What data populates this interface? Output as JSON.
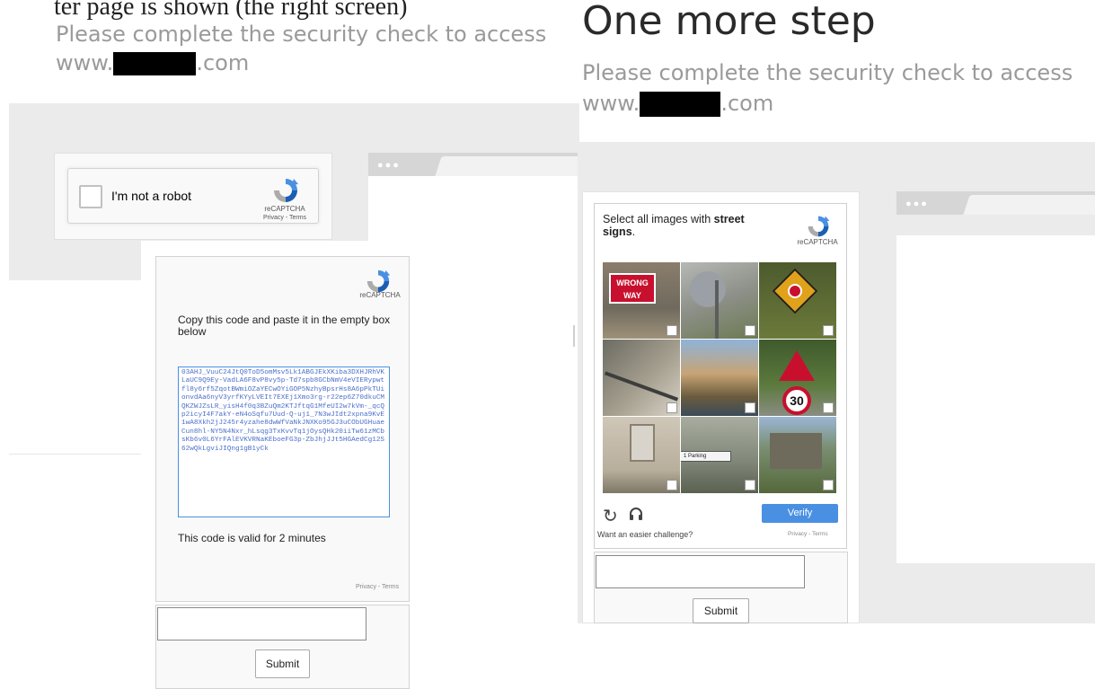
{
  "left_panel": {
    "cropped_caption": "ter page is shown (the right screen)",
    "subtitle_prefix": "Please complete the security check to access",
    "url_prefix": "www.",
    "url_suffix": ".com",
    "checkbox_widget": {
      "label": "I'm not a robot",
      "brand": "reCAPTCHA",
      "links": "Privacy - Terms"
    },
    "code_widget": {
      "brand": "reCAPTCHA",
      "instruction": "Copy this code and paste it in the empty box below",
      "code": "03AHJ_VuuC24JtQ0ToD5omMsv5Lk1ABGJEkXKiba3DXHJRhVKLaUC9Q9Ey-VadLA6F8vP8vy5p-Td7spb8GCbNmV4eVIERypwtfl8y6rf5ZqotBWmiOZaYECwOYiGOP5NzhyBpsrHs8A6pPkTUionvdAa6nyV3yrfKYyLVEIt7EXEj1Xmo3rg-r22ep6Z70dkuCMQKZWJZsLR_yisH4f0q3BZuQm2KTJftqG1MfeUI2w7kVm-_qcQp2icyI4F7akY-eN4oSqfu7Uud-Q-uj1_7N3wJIdt2xpna9KvE1wA8Xkh2jJ245r4yzahe8dwWfVaNkJNXKo95GJ3uCObUGHuaeCun8hl-NY5N4Nxr_hLsqg3TxKvvTq1jOysQHk20iiTw61zMCbsKb6v0L6YrFAlEVKVRNaKEboeFG3p-ZbJhjJJt5HGAedCg12S62wQkLgviJIQng1gB1yCk",
      "validity": "This code is valid for 2 minutes",
      "links": "Privacy - Terms",
      "input_placeholder": "",
      "submit_label": "Submit"
    }
  },
  "right_panel": {
    "title": "One more step",
    "subtitle_prefix": "Please complete the security check to access",
    "url_prefix": "www.",
    "url_suffix": ".com",
    "challenge": {
      "instruction_prefix": "Select all images with ",
      "instruction_bold": "street signs",
      "instruction_suffix": ".",
      "brand": "reCAPTCHA",
      "tile_sign_text": "WRONG WAY",
      "speed_sign_text": "30",
      "pointer_sign_text": "1 Parking",
      "verify_label": "Verify",
      "easier_text": "Want an easier challenge?",
      "links": "Privacy - Terms",
      "submit_label": "Submit"
    }
  },
  "colors": {
    "accent": "#4a90e2",
    "panel_gray": "#ebebeb",
    "muted_text": "#9a9a9a"
  }
}
